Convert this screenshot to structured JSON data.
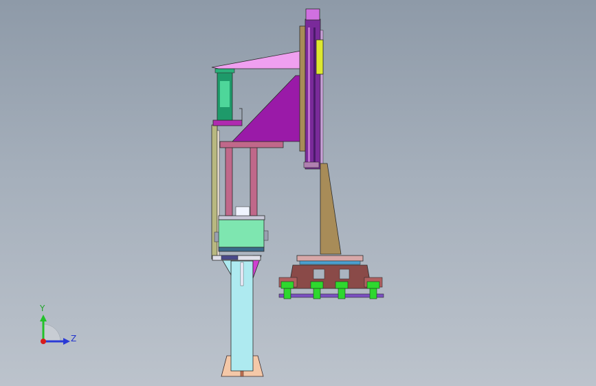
{
  "viewport": {
    "background_top": "#8e9aa8",
    "background_bottom": "#bcc3cc"
  },
  "triad": {
    "y_label": "Y",
    "z_label": "Z",
    "y_color": "#22c22a",
    "z_color": "#2a3ad6",
    "origin_color": "#d81c1c"
  },
  "model": {
    "colors": {
      "frame": "#5a4a40",
      "post": "#aeeaf0",
      "bracket_magenta": "#b02ab0",
      "plate_pink": "#f0a0f0",
      "beam_mauve": "#c0688a",
      "motor_green": "#1e9a6a",
      "block_mint": "#7ee6b0",
      "column_olive": "#a88c58",
      "rail_purple": "#7a2a9a",
      "slider_yellow": "#dde830",
      "gripper_brown": "#8a4a48",
      "suction_green": "#2ed82e"
    }
  }
}
